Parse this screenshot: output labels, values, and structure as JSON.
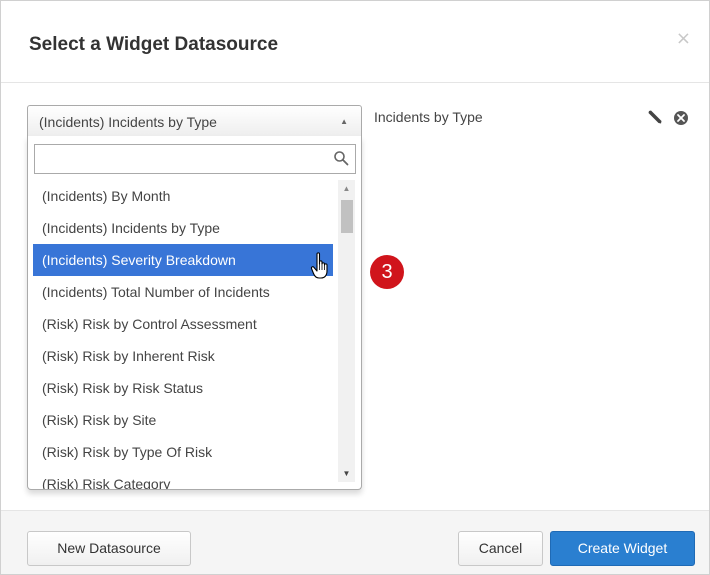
{
  "modal": {
    "title": "Select a Widget Datasource",
    "close_label": "×"
  },
  "select": {
    "value": "(Incidents) Incidents by Type",
    "arrow": "▲"
  },
  "search": {
    "value": "",
    "placeholder": ""
  },
  "options": [
    "(Incidents) By Month",
    "(Incidents) Incidents by Type",
    "(Incidents) Severity Breakdown",
    "(Incidents) Total Number of Incidents",
    "(Risk) Risk by Control Assessment",
    "(Risk) Risk by Inherent Risk",
    "(Risk) Risk by Risk Status",
    "(Risk) Risk by Site",
    "(Risk) Risk by Type Of Risk",
    "(Risk) Risk Category"
  ],
  "highlighted_option": "(Incidents) Severity Breakdown",
  "scrollbar": {
    "up": "▲",
    "down": "▼"
  },
  "selected_datasource": {
    "name": "Incidents by Type",
    "edit_icon": "pencil-icon",
    "remove_icon": "remove-circle-icon"
  },
  "step_badge": "3",
  "footer": {
    "new_datasource": "New Datasource",
    "cancel": "Cancel",
    "create_widget": "Create Widget"
  },
  "colors": {
    "primary": "#2a7fd0",
    "highlight": "#3875d7",
    "badge": "#d0141b"
  }
}
